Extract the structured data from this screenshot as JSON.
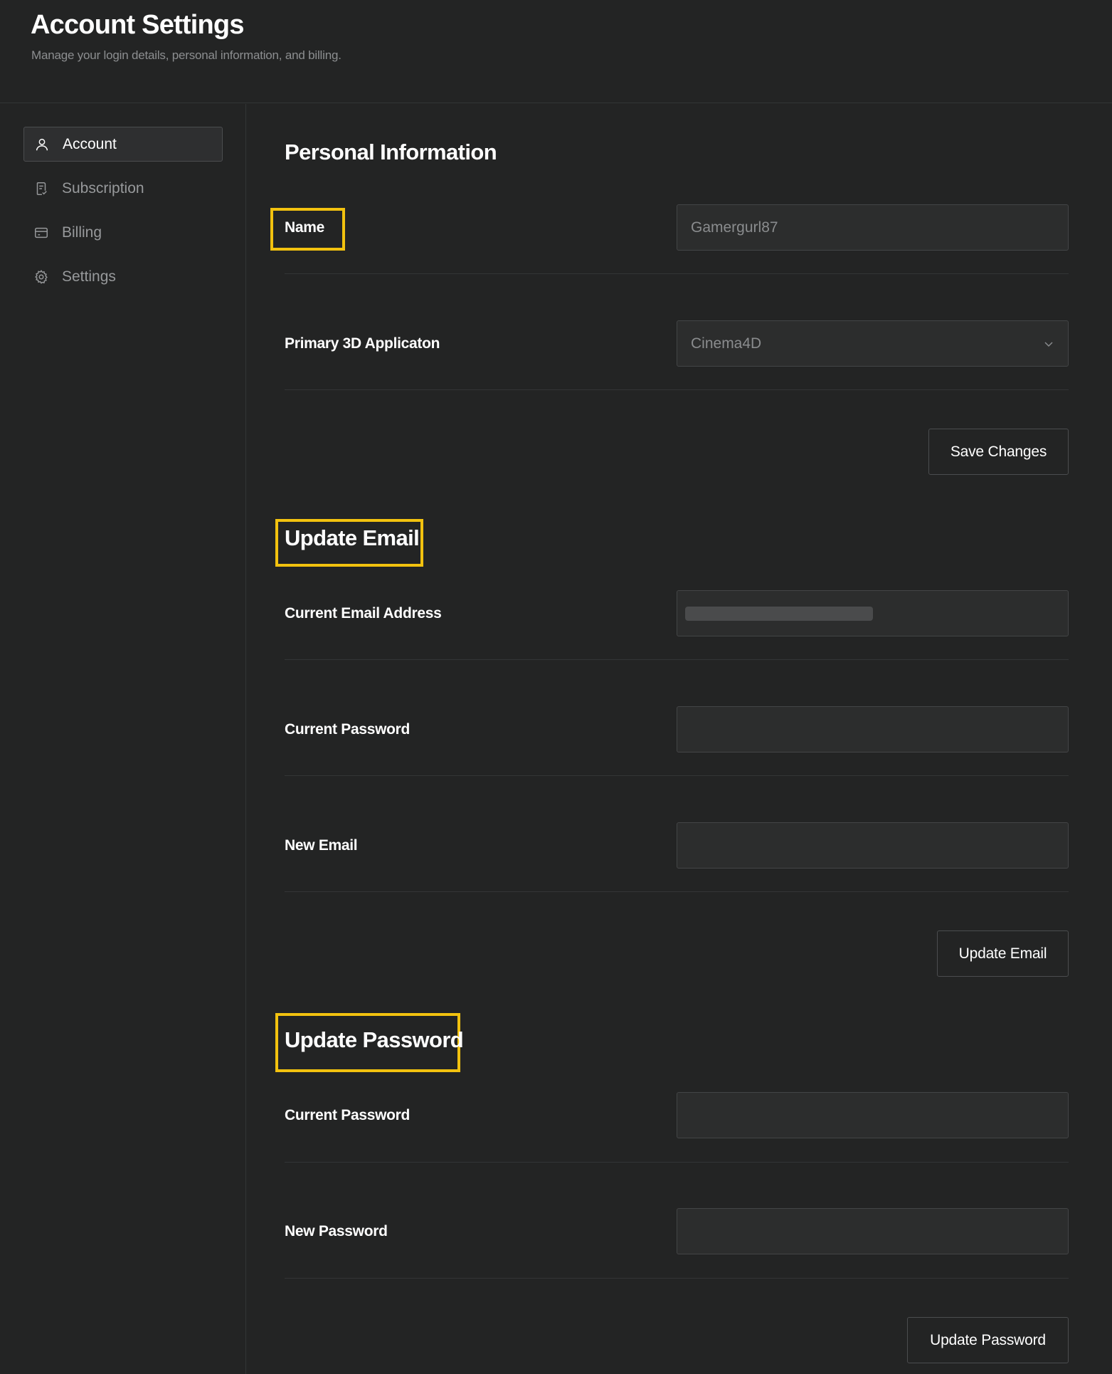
{
  "header": {
    "title": "Account Settings",
    "subtitle": "Manage your login details, personal information, and billing."
  },
  "sidebar": {
    "items": [
      {
        "label": "Account",
        "icon": "user-icon",
        "active": true
      },
      {
        "label": "Subscription",
        "icon": "receipt-icon",
        "active": false
      },
      {
        "label": "Billing",
        "icon": "credit-card-icon",
        "active": false
      },
      {
        "label": "Settings",
        "icon": "gear-icon",
        "active": false
      }
    ]
  },
  "personal_info": {
    "title": "Personal Information",
    "name_label": "Name",
    "name_value": "Gamergurl87",
    "app_label": "Primary 3D Applicaton",
    "app_value": "Cinema4D",
    "save_label": "Save Changes"
  },
  "update_email": {
    "title": "Update Email",
    "current_email_label": "Current Email Address",
    "current_password_label": "Current Password",
    "new_email_label": "New Email",
    "button_label": "Update Email"
  },
  "update_password": {
    "title": "Update Password",
    "current_password_label": "Current Password",
    "new_password_label": "New Password",
    "button_label": "Update Password"
  },
  "colors": {
    "background": "#232424",
    "highlight": "#f2c20f",
    "input_bg": "#2c2d2d",
    "border": "#434546"
  }
}
